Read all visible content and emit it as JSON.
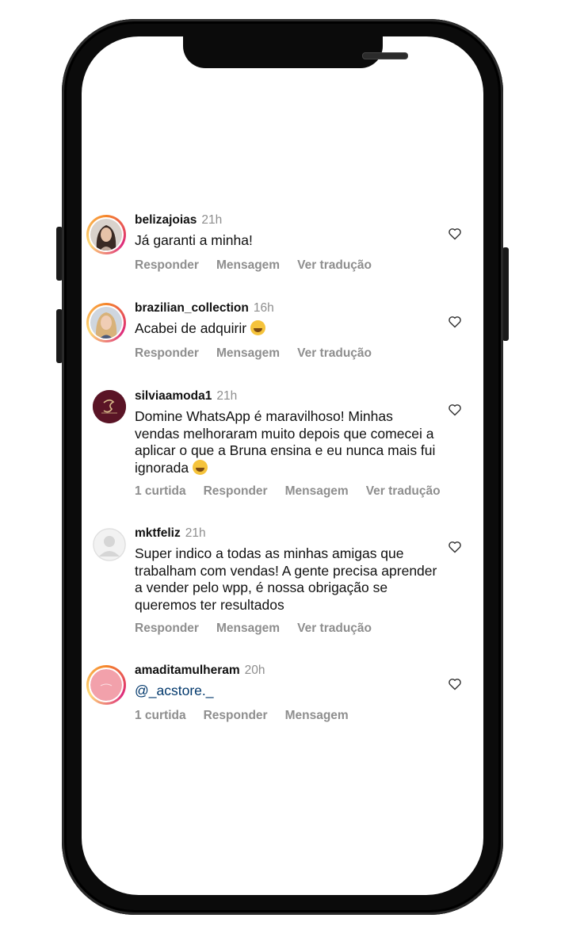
{
  "comments": [
    {
      "username": "belizajoias",
      "time": "21h",
      "text": "Já garanti a minha!",
      "actions": [
        "Responder",
        "Mensagem",
        "Ver tradução"
      ],
      "avatar": "photo-woman-dark-hair-icon",
      "story_ring": true
    },
    {
      "username": "brazilian_collection",
      "time": "16h",
      "text": "Acabei de adquirir",
      "emoji": "star-struck-face-emoji",
      "actions": [
        "Responder",
        "Mensagem",
        "Ver tradução"
      ],
      "avatar": "photo-woman-blonde-hair-icon",
      "story_ring": true
    },
    {
      "username": "silviaamoda1",
      "time": "21h",
      "text": "Domine WhatsApp é maravilhoso! Minhas vendas melhoraram muito depois que comecei a aplicar o que a Bruna ensina e eu nunca mais fui ignorada",
      "emoji": "laughing-tears-face-emoji",
      "actions": [
        "1 curtida",
        "Responder",
        "Mensagem",
        "Ver tradução"
      ],
      "avatar": "brand-logo-maroon-icon",
      "story_ring": false
    },
    {
      "username": "mktfeliz",
      "time": "21h",
      "text": "Super indico a todas as minhas amigas que trabalham com vendas! A gente precisa aprender a vender pelo wpp, é nossa obrigação se queremos ter resultados",
      "actions": [
        "Responder",
        "Mensagem",
        "Ver tradução"
      ],
      "avatar": "default-user-icon",
      "story_ring": false
    },
    {
      "username": "amaditamulheram",
      "time": "20h",
      "text": "@_acstore._",
      "actions": [
        "1 curtida",
        "Responder",
        "Mensagem"
      ],
      "avatar": "pink-logo-icon",
      "story_ring": true
    }
  ],
  "colors": {
    "text": "#111111",
    "secondary": "#8e8e8e",
    "mention": "#00376b",
    "frame": "#0b0b0b"
  },
  "icons": {
    "like": "heart-outline-icon"
  }
}
